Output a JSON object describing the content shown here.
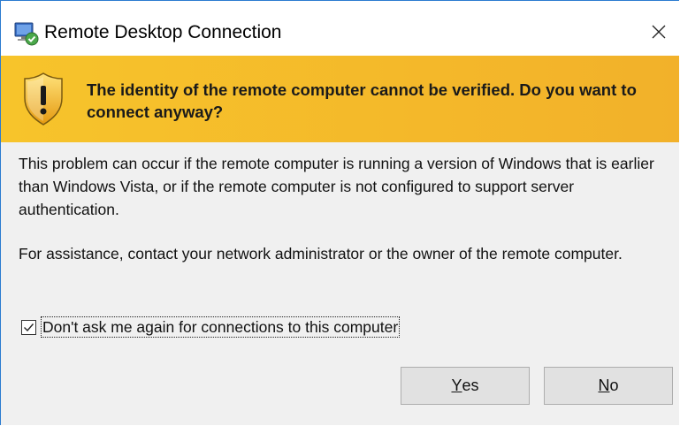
{
  "window": {
    "title": "Remote Desktop Connection",
    "close_glyph": "✕",
    "app_icon": "remote-desktop-icon"
  },
  "banner": {
    "icon": "warning-shield-icon",
    "heading": "The identity of the remote computer cannot be verified. Do you want to connect anyway?",
    "background": "#f4b92b"
  },
  "body": {
    "paragraph1": "This problem can occur if the remote computer is running a version of Windows that is earlier than Windows Vista, or if the remote computer is not configured to support server authentication.",
    "paragraph2": "For assistance, contact your network administrator or the owner of the remote computer."
  },
  "checkbox": {
    "label": "Don't ask me again for connections to this computer",
    "checked": true
  },
  "buttons": {
    "yes": {
      "mnemonic": "Y",
      "rest": "es"
    },
    "no": {
      "mnemonic": "N",
      "rest": "o"
    }
  }
}
